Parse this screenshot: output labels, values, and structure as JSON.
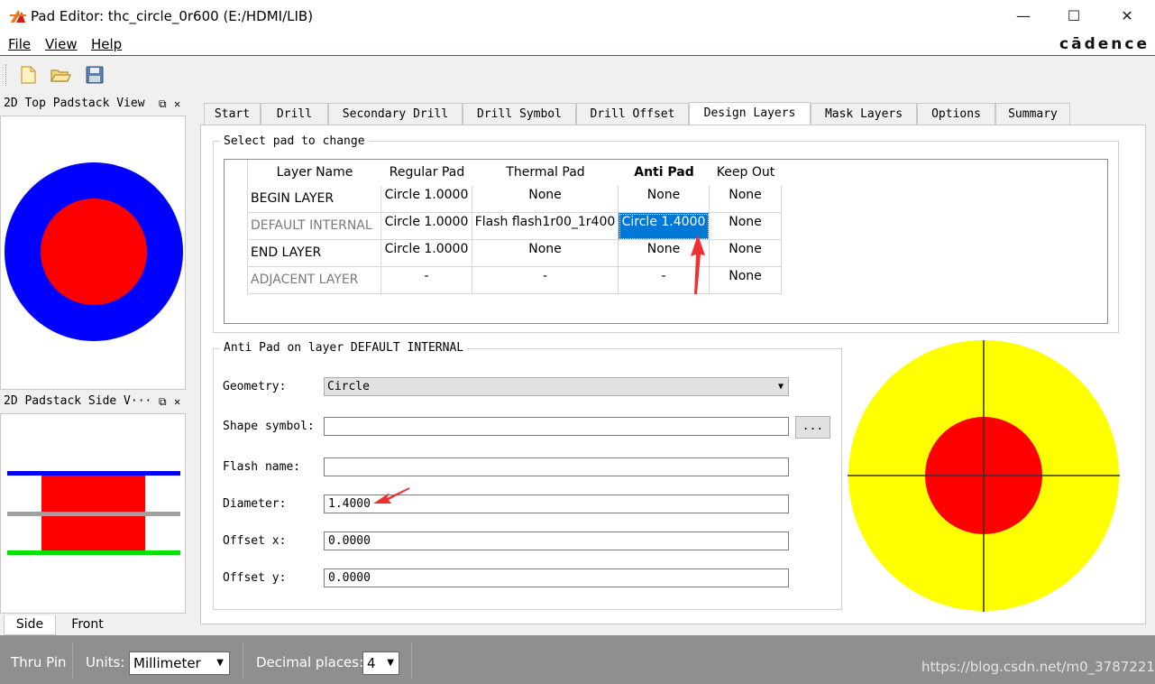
{
  "window": {
    "title": "Pad Editor: thc_circle_0r600  (E:/HDMI/LIB)",
    "minimize": "—",
    "maximize": "☐",
    "close": "✕"
  },
  "menu": {
    "items": [
      "File",
      "View",
      "Help"
    ],
    "brand": "cādence"
  },
  "toolbar": {
    "icons": [
      "new-file-icon",
      "open-folder-icon",
      "save-icon"
    ]
  },
  "top_view": {
    "title": "2D Top Padstack View"
  },
  "side_view": {
    "title": "2D Padstack Side V···",
    "tabs": [
      "Side",
      "Front"
    ]
  },
  "tabs": [
    "Start",
    "Drill",
    "Secondary Drill",
    "Drill Symbol",
    "Drill Offset",
    "Design Layers",
    "Mask Layers",
    "Options",
    "Summary"
  ],
  "active_tab": "Design Layers",
  "pad_table": {
    "group_label": "Select pad to change",
    "columns": [
      "Layer Name",
      "Regular Pad",
      "Thermal Pad",
      "Anti Pad",
      "Keep Out"
    ],
    "rows": [
      [
        "BEGIN LAYER",
        "Circle 1.0000",
        "None",
        "None",
        "None"
      ],
      [
        "DEFAULT INTERNAL",
        "Circle 1.0000",
        "Flash flash1r00_1r400",
        "Circle 1.4000",
        "None"
      ],
      [
        "END LAYER",
        "Circle 1.0000",
        "None",
        "None",
        "None"
      ],
      [
        "ADJACENT LAYER",
        "-",
        "-",
        "-",
        "None"
      ]
    ],
    "selected": "Circle 1.4000"
  },
  "anti_pad_form": {
    "group_label": "Anti Pad on layer DEFAULT INTERNAL",
    "geometry_label": "Geometry:",
    "geometry_value": "Circle",
    "shape_label": "Shape symbol:",
    "shape_value": "",
    "browse": "...",
    "flash_label": "Flash name:",
    "flash_value": "",
    "diameter_label": "Diameter:",
    "diameter_value": "1.4000",
    "offset_x_label": "Offset x:",
    "offset_x_value": "0.0000",
    "offset_y_label": "Offset y:",
    "offset_y_value": "0.0000"
  },
  "status": {
    "mode": "Thru Pin",
    "units_label": "Units:",
    "units_value": "Millimeter",
    "decimal_label": "Decimal places:",
    "decimal_value": "4",
    "watermark": "https://blog.csdn.net/m0_37872216"
  },
  "colors": {
    "pad_red": "#ff0000",
    "top_blue": "#0000ff",
    "anti_yellow": "#ffff00",
    "selection": "#0078d7",
    "arrow": "#f03030"
  }
}
